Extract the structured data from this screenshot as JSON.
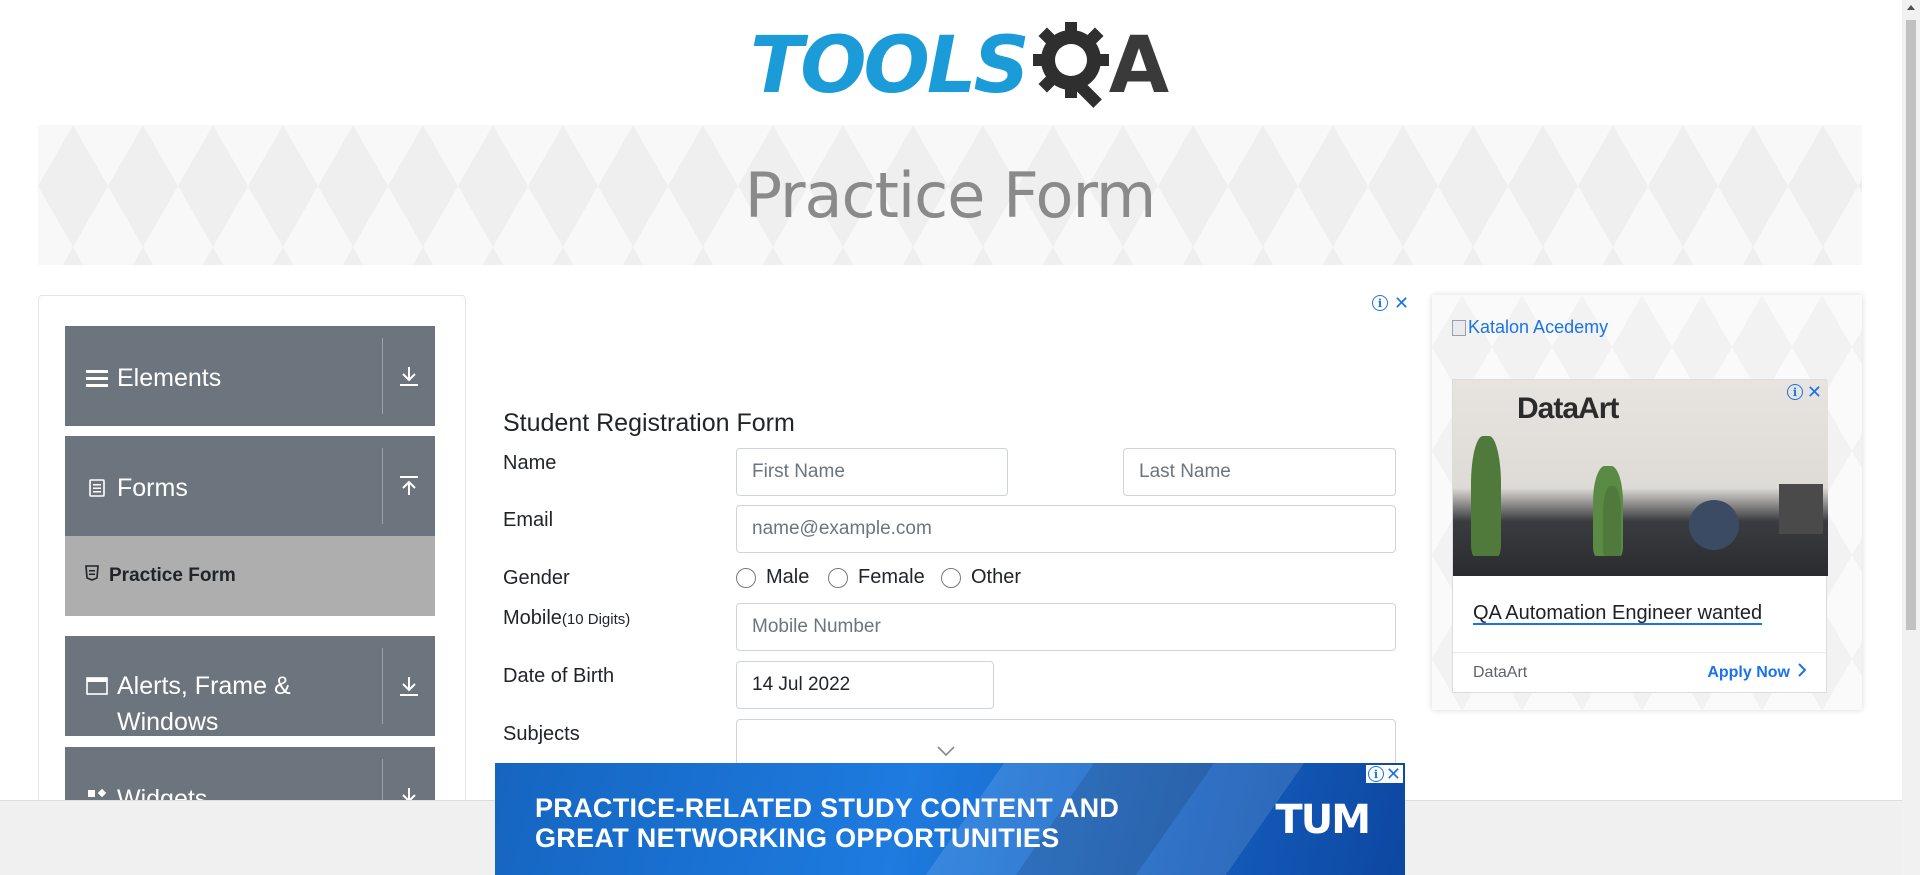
{
  "logo": {
    "text_tools": "TOOLS",
    "text_qa_letter": "A"
  },
  "banner": {
    "title": "Practice Form"
  },
  "sidebar": {
    "groups": [
      {
        "label": "Elements",
        "icon": "hamburger-icon",
        "state": "collapsed"
      },
      {
        "label": "Forms",
        "icon": "document-icon",
        "state": "expanded"
      },
      {
        "label": "Alerts, Frame &",
        "label_line2": "Windows",
        "icon": "window-icon",
        "state": "collapsed"
      },
      {
        "label": "Widgets",
        "icon": "widgets-icon",
        "state": "collapsed"
      }
    ],
    "forms_items": [
      {
        "label": "Practice Form",
        "active": true
      }
    ]
  },
  "form": {
    "title": "Student Registration Form",
    "name_label": "Name",
    "first_name_placeholder": "First Name",
    "last_name_placeholder": "Last Name",
    "email_label": "Email",
    "email_placeholder": "name@example.com",
    "gender_label": "Gender",
    "gender_options": [
      "Male",
      "Female",
      "Other"
    ],
    "mobile_label": "Mobile",
    "mobile_hint": "(10 Digits)",
    "mobile_placeholder": "Mobile Number",
    "dob_label": "Date of Birth",
    "dob_value": "14 Jul 2022",
    "subjects_label": "Subjects"
  },
  "right_ad": {
    "image_alt": "Katalon Acedemy",
    "card_brand": "DataArt",
    "headline": "QA Automation Engineer wanted",
    "advertiser": "DataArt",
    "cta": "Apply Now"
  },
  "bottom_ad": {
    "line1": "PRACTICE-RELATED STUDY CONTENT AND",
    "line2": "GREAT NETWORKING OPPORTUNITIES",
    "brand": "TUM"
  },
  "colors": {
    "brand_blue": "#1b9bd7",
    "sidebar_group_bg": "#6c757d",
    "sidebar_active_bg": "#aeaeae",
    "ad_link": "#1a73e8",
    "bottom_ad_bg": "#1565c0"
  }
}
